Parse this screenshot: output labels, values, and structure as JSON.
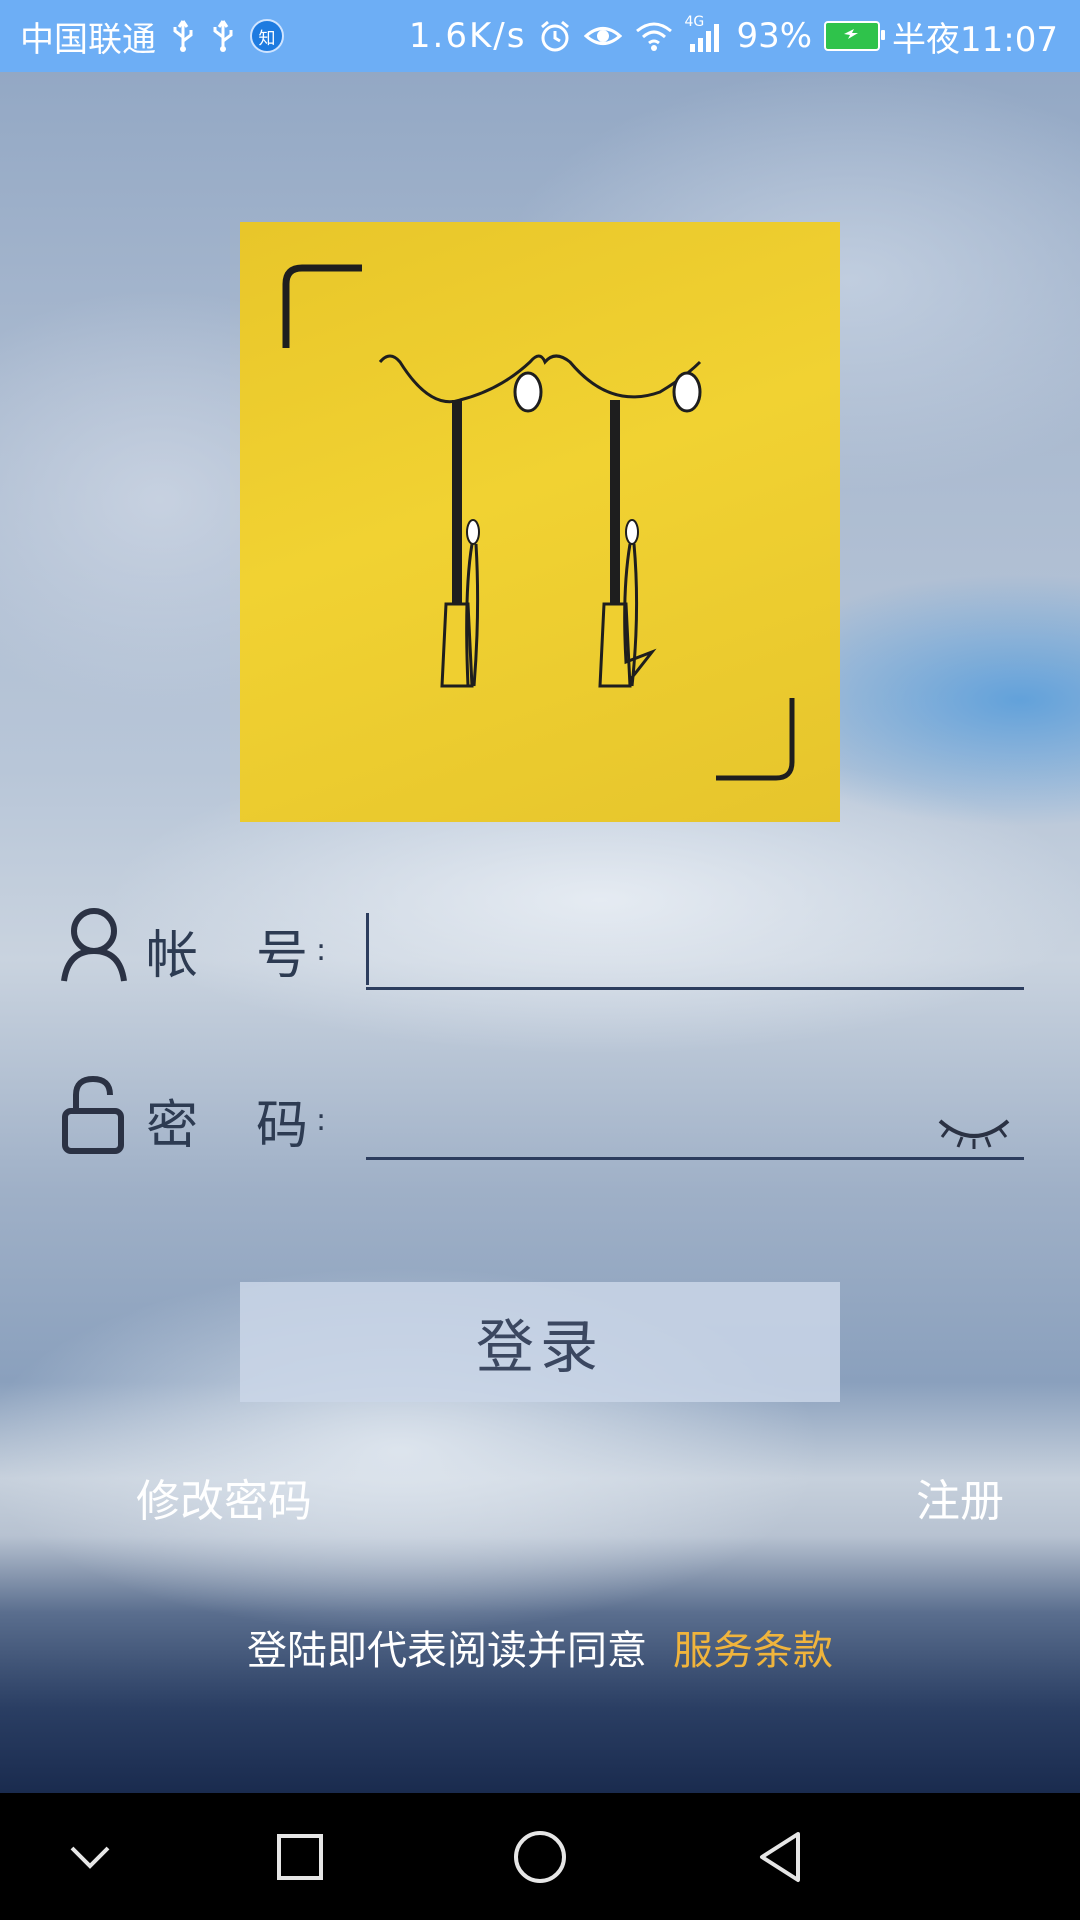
{
  "status_bar": {
    "carrier": "中国联通",
    "usb1_icon": "usb-icon",
    "usb2_icon": "usb-icon",
    "app_badge": "知",
    "net_speed": "1.6K/s",
    "alarm_icon": "alarm-icon",
    "eye_icon": "eye-comfort-icon",
    "wifi_icon": "wifi-icon",
    "signal_label": "4G",
    "battery_percent": "93%",
    "battery_fill": 0.93,
    "time": "半夜11:07"
  },
  "logo": {
    "icon": "street-lamps-logo",
    "background": "#eccb2e"
  },
  "form": {
    "account": {
      "icon": "user-icon",
      "label_1": "帐",
      "label_2": "号",
      "colon": ":",
      "value": "",
      "placeholder": ""
    },
    "password": {
      "icon": "unlock-icon",
      "label_1": "密",
      "label_2": "码",
      "colon": ":",
      "value": "",
      "placeholder": "",
      "toggle_icon": "eye-closed-icon"
    }
  },
  "actions": {
    "login_label": "登录",
    "change_password_label": "修改密码",
    "register_label": "注册"
  },
  "terms": {
    "text": "登陆即代表阅读并同意",
    "link_label": "服务条款",
    "link_color": "#f0b43c"
  },
  "nav_bar": {
    "buttons": [
      "chevron-down-icon",
      "recents-square-icon",
      "home-circle-icon",
      "back-triangle-icon"
    ]
  }
}
